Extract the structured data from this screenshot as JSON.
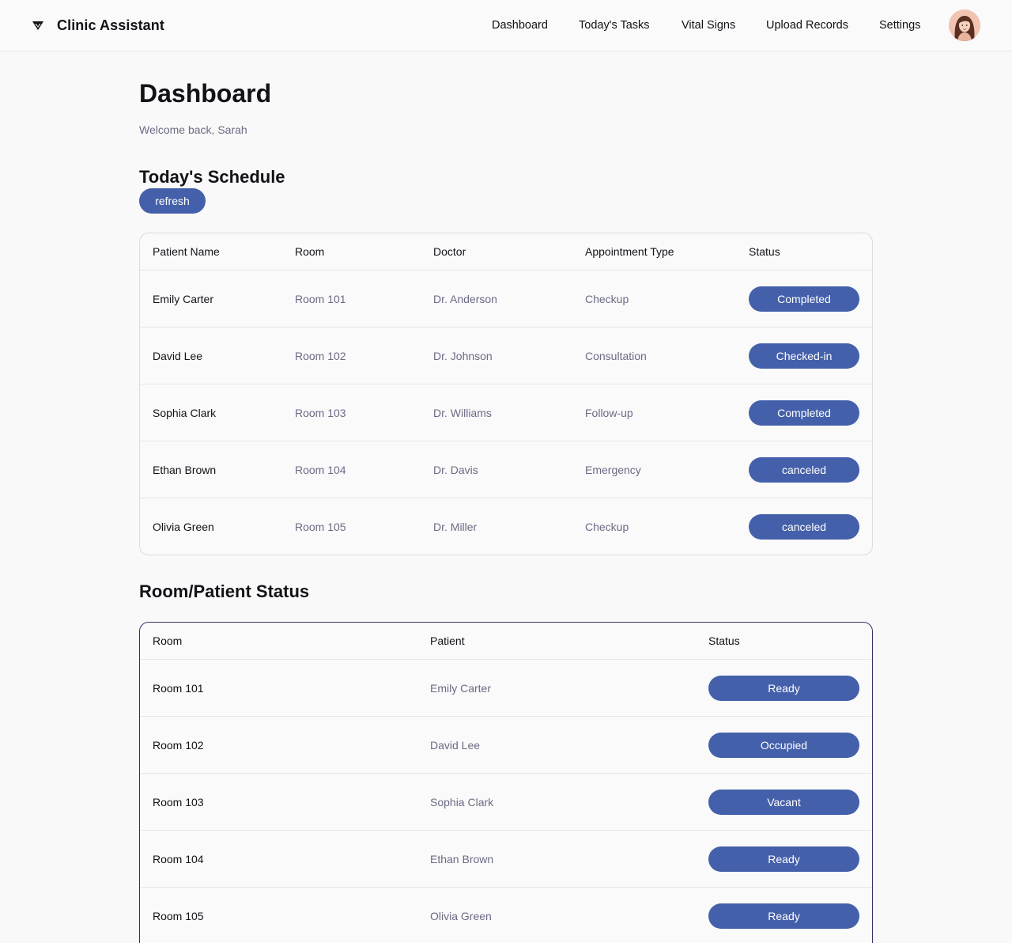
{
  "app": {
    "name": "Clinic Assistant"
  },
  "nav": [
    {
      "label": "Dashboard"
    },
    {
      "label": "Today's Tasks"
    },
    {
      "label": "Vital Signs"
    },
    {
      "label": "Upload Records"
    },
    {
      "label": "Settings"
    }
  ],
  "page": {
    "title": "Dashboard",
    "welcome": "Welcome back, Sarah"
  },
  "schedule": {
    "title": "Today's Schedule",
    "refresh_label": "refresh",
    "columns": [
      "Patient Name",
      "Room",
      "Doctor",
      "Appointment Type",
      "Status"
    ],
    "rows": [
      {
        "patient": "Emily Carter",
        "room": "Room 101",
        "doctor": "Dr. Anderson",
        "type": "Checkup",
        "status": "Completed"
      },
      {
        "patient": "David Lee",
        "room": "Room 102",
        "doctor": "Dr. Johnson",
        "type": "Consultation",
        "status": "Checked-in"
      },
      {
        "patient": "Sophia Clark",
        "room": "Room 103",
        "doctor": "Dr. Williams",
        "type": "Follow-up",
        "status": "Completed"
      },
      {
        "patient": "Ethan Brown",
        "room": "Room 104",
        "doctor": "Dr. Davis",
        "type": "Emergency",
        "status": "canceled"
      },
      {
        "patient": "Olivia Green",
        "room": "Room 105",
        "doctor": "Dr. Miller",
        "type": "Checkup",
        "status": "canceled"
      }
    ]
  },
  "room_status": {
    "title": "Room/Patient Status",
    "columns": [
      "Room",
      "Patient",
      "Status"
    ],
    "rows": [
      {
        "room": "Room 101",
        "patient": "Emily Carter",
        "status": "Ready"
      },
      {
        "room": "Room 102",
        "patient": "David Lee",
        "status": "Occupied"
      },
      {
        "room": "Room 103",
        "patient": "Sophia Clark",
        "status": "Vacant"
      },
      {
        "room": "Room 104",
        "patient": "Ethan Brown",
        "status": "Ready"
      },
      {
        "room": "Room 105",
        "patient": "Olivia Green",
        "status": "Ready"
      }
    ]
  },
  "colors": {
    "accent": "#4460aa",
    "muted_text": "#6b6b84",
    "border": "#dcdce2"
  },
  "icons": {
    "brand": "brand-logo-icon",
    "avatar": "user-avatar"
  }
}
